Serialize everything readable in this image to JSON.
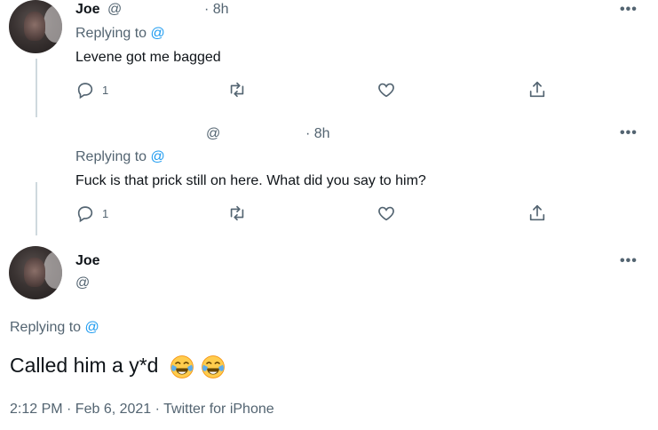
{
  "tweets": [
    {
      "name": "Joe",
      "handle_at": "@",
      "time": "· 8h",
      "more": "•••",
      "replying_label": "Replying to",
      "replying_handle": "@",
      "text": "Levene got me bagged",
      "reply_count": "1"
    },
    {
      "name": "",
      "handle_at": "@",
      "time": "· 8h",
      "more": "•••",
      "replying_label": "Replying to",
      "replying_handle": "@",
      "text": "Fuck is that prick still on here. What did you say to him?",
      "reply_count": "1"
    }
  ],
  "main": {
    "name": "Joe",
    "handle_at": "@",
    "more": "•••",
    "replying_label": "Replying to",
    "replying_handle": "@",
    "text": "Called him a y*d",
    "emoji": "face-with-tears-of-joy-icon x2",
    "time": "2:12 PM · Feb 6, 2021",
    "separator": "·",
    "source": "Twitter for iPhone"
  },
  "colors": {
    "accent": "#1d9bf0",
    "muted": "#536471",
    "text": "#0f1419"
  }
}
